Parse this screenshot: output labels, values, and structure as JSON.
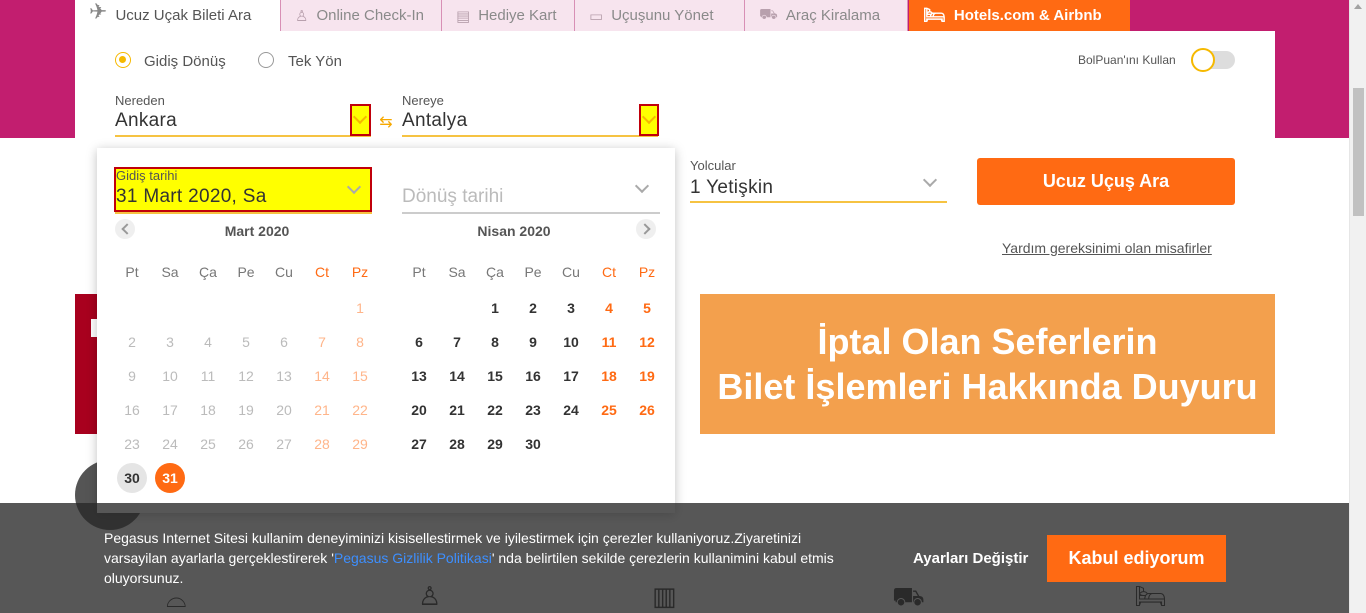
{
  "tabs": [
    {
      "label": "Ucuz Uçak Bileti Ara",
      "icon": "airplane-icon"
    },
    {
      "label": "Online Check-In",
      "icon": "seat-icon"
    },
    {
      "label": "Hediye Kart",
      "icon": "gift-icon"
    },
    {
      "label": "Uçuşunu Yönet",
      "icon": "ticket-icon"
    },
    {
      "label": "Araç Kiralama",
      "icon": "car-icon"
    },
    {
      "label": "Hotels.com & Airbnb",
      "icon": "bed-icon"
    }
  ],
  "trip_type": {
    "round_trip": "Gidiş Dönüş",
    "one_way": "Tek Yön",
    "selected": "round_trip"
  },
  "bolpuan_label": "BolPuan'ını Kullan",
  "from": {
    "label": "Nereden",
    "value": "Ankara"
  },
  "to": {
    "label": "Nereye",
    "value": "Antalya"
  },
  "departure": {
    "label": "Gidiş tarihi",
    "value": "31 Mart 2020, Sa"
  },
  "return": {
    "placeholder": "Dönüş tarihi"
  },
  "passengers": {
    "label": "Yolcular",
    "value": "1 Yetişkin"
  },
  "search_button": "Ucuz Uçuş Ara",
  "help_link": "Yardım gereksinimi olan misafirler",
  "calendar": {
    "weekdays": [
      "Pt",
      "Sa",
      "Ça",
      "Pe",
      "Cu",
      "Ct",
      "Pz"
    ],
    "months": [
      {
        "title": "Mart 2020",
        "weeks": [
          [
            "",
            "",
            "",
            "",
            "",
            "",
            "1"
          ],
          [
            "2",
            "3",
            "4",
            "5",
            "6",
            "7",
            "8"
          ],
          [
            "9",
            "10",
            "11",
            "12",
            "13",
            "14",
            "15"
          ],
          [
            "16",
            "17",
            "18",
            "19",
            "20",
            "21",
            "22"
          ],
          [
            "23",
            "24",
            "25",
            "26",
            "27",
            "28",
            "29"
          ],
          [
            "30",
            "31",
            "",
            "",
            "",
            "",
            ""
          ]
        ],
        "today": "30",
        "selected": "31"
      },
      {
        "title": "Nisan 2020",
        "weeks": [
          [
            "",
            "",
            "1",
            "2",
            "3",
            "4",
            "5"
          ],
          [
            "6",
            "7",
            "8",
            "9",
            "10",
            "11",
            "12"
          ],
          [
            "13",
            "14",
            "15",
            "16",
            "17",
            "18",
            "19"
          ],
          [
            "20",
            "21",
            "22",
            "23",
            "24",
            "25",
            "26"
          ],
          [
            "27",
            "28",
            "29",
            "30",
            "",
            "",
            ""
          ]
        ]
      }
    ]
  },
  "promo": {
    "line1": "İptal Olan Seferlerin",
    "line2": "Bilet İşlemleri Hakkında Duyuru"
  },
  "cookie": {
    "text_before": "Pegasus Internet Sitesi kullanim deneyiminizi kisisellestirmek ve iyilestirmek için çerezler kullaniyoruz.Ziyaretinizi varsayilan ayarlarla gerçeklestirerek '",
    "link": "Pegasus Gizlilik Politikasi",
    "text_after": "' nda belirtilen sekilde çerezlerin kullanimini kabul etmis oluyorsunuz.",
    "settings": "Ayarları Değiştir",
    "accept": "Kabul ediyorum"
  },
  "colors": {
    "brand_pink": "#c21e6f",
    "accent_orange": "#ff6a13",
    "accent_yellow": "#f6b900",
    "promo_orange": "#f3a04d"
  }
}
